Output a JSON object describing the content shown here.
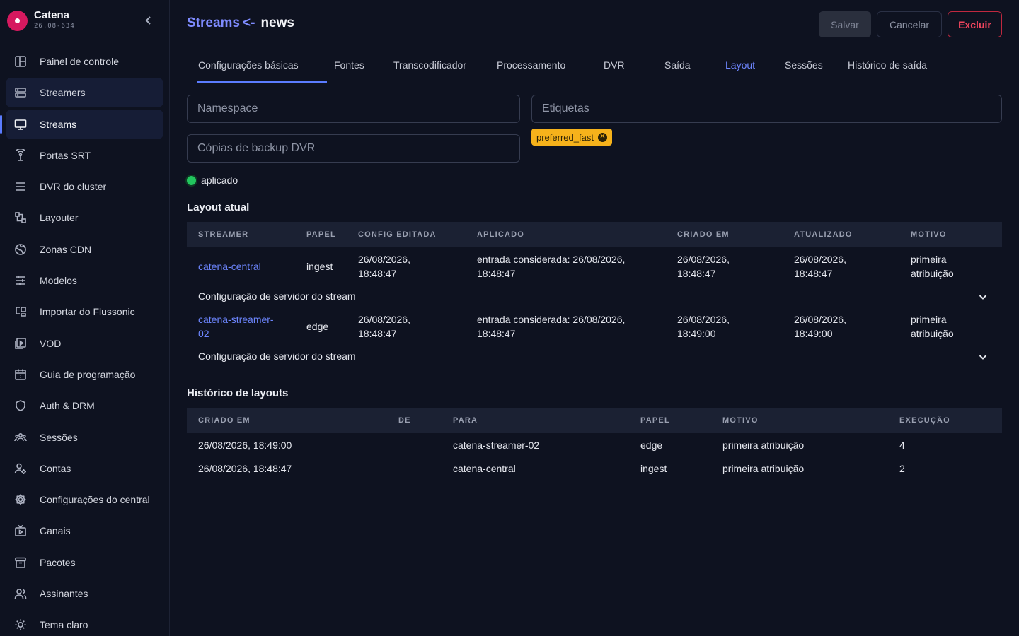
{
  "brand": {
    "name": "Catena",
    "version": "26.08-634"
  },
  "sidebar": {
    "items": [
      {
        "label": "Painel de controle",
        "icon": "dashboard-icon"
      },
      {
        "label": "Streamers",
        "icon": "server-icon"
      },
      {
        "label": "Streams",
        "icon": "monitor-icon"
      },
      {
        "label": "Portas SRT",
        "icon": "antenna-icon"
      },
      {
        "label": "DVR do cluster",
        "icon": "storage-icon"
      },
      {
        "label": "Layouter",
        "icon": "layout-icon"
      },
      {
        "label": "Zonas CDN",
        "icon": "globe-icon"
      },
      {
        "label": "Modelos",
        "icon": "sliders-icon"
      },
      {
        "label": "Importar do Flussonic",
        "icon": "import-icon"
      },
      {
        "label": "VOD",
        "icon": "video-icon"
      },
      {
        "label": "Guia de programação",
        "icon": "calendar-icon"
      },
      {
        "label": "Auth & DRM",
        "icon": "shield-icon"
      },
      {
        "label": "Sessões",
        "icon": "users-icon"
      },
      {
        "label": "Contas",
        "icon": "account-icon"
      },
      {
        "label": "Configurações do central",
        "icon": "gear-icon"
      },
      {
        "label": "Canais",
        "icon": "tv-icon"
      },
      {
        "label": "Pacotes",
        "icon": "archive-icon"
      },
      {
        "label": "Assinantes",
        "icon": "subscribers-icon"
      },
      {
        "label": "Tema claro",
        "icon": "sun-icon"
      }
    ]
  },
  "header": {
    "crumb": "Streams",
    "arrow": "<-",
    "name": "news",
    "save_label": "Salvar",
    "cancel_label": "Cancelar",
    "delete_label": "Excluir"
  },
  "tabs": [
    "Configurações básicas",
    "Fontes",
    "Transcodificador",
    "Processamento",
    "DVR",
    "Saída",
    "Layout",
    "Sessões",
    "Histórico de saída"
  ],
  "active_tab": "Layout",
  "form": {
    "namespace_placeholder": "Namespace",
    "tags_placeholder": "Etiquetas",
    "dvr_backup_placeholder": "Cópias de backup DVR",
    "tag": "preferred_fast",
    "status": "aplicado"
  },
  "current_layout": {
    "title": "Layout atual",
    "columns": [
      "STREAMER",
      "PAPEL",
      "CONFIG EDITADA",
      "APLICADO",
      "CRIADO EM",
      "ATUALIZADO",
      "MOTIVO"
    ],
    "rows": [
      {
        "streamer_1": "catena-central",
        "streamer_2": "",
        "role": "ingest",
        "config_1": "26/08/2026,",
        "config_2": "18:48:47",
        "applied_1": "entrada considerada: 26/08/2026,",
        "applied_2": "18:48:47",
        "created_1": "26/08/2026,",
        "created_2": "18:48:47",
        "updated_1": "26/08/2026,",
        "updated_2": "18:48:47",
        "reason_1": "primeira",
        "reason_2": "atribuição",
        "expander": "Configuração de servidor do stream"
      },
      {
        "streamer_1": "catena-streamer-",
        "streamer_2": "02",
        "role": "edge",
        "config_1": "26/08/2026,",
        "config_2": "18:48:47",
        "applied_1": "entrada considerada: 26/08/2026,",
        "applied_2": "18:48:47",
        "created_1": "26/08/2026,",
        "created_2": "18:49:00",
        "updated_1": "26/08/2026,",
        "updated_2": "18:49:00",
        "reason_1": "primeira",
        "reason_2": "atribuição",
        "expander": "Configuração de servidor do stream"
      }
    ]
  },
  "history": {
    "title": "Histórico de layouts",
    "columns": [
      "CRIADO EM",
      "DE",
      "PARA",
      "PAPEL",
      "MOTIVO",
      "EXECUÇÃO"
    ],
    "rows": [
      {
        "created": "26/08/2026, 18:49:00",
        "from": "",
        "to": "catena-streamer-02",
        "role": "edge",
        "reason": "primeira atribuição",
        "run": "4"
      },
      {
        "created": "26/08/2026, 18:48:47",
        "from": "",
        "to": "catena-central",
        "role": "ingest",
        "reason": "primeira atribuição",
        "run": "2"
      }
    ]
  },
  "colors": {
    "accent": "#5b7cff",
    "danger": "#f0455e",
    "tag": "#f6b21b",
    "ok": "#22c55e"
  }
}
